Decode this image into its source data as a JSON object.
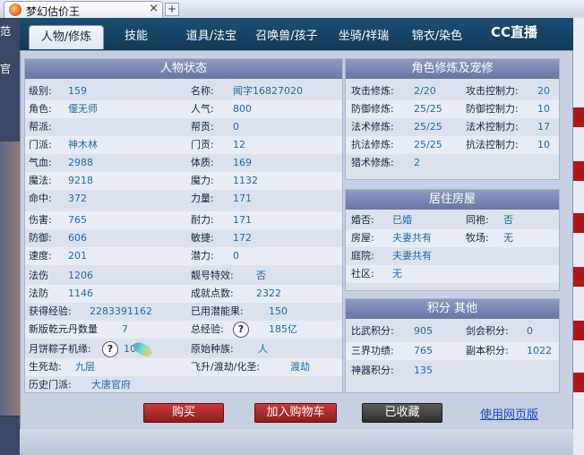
{
  "browser": {
    "tab_title": "梦幻估价王",
    "close": "×",
    "new_tab": "+",
    "left_text": "范",
    "left_text2": "官"
  },
  "tabs": [
    {
      "label": "人物/修炼",
      "active": true
    },
    {
      "label": "技能"
    },
    {
      "label": "道具/法宝"
    },
    {
      "label": "召唤兽/孩子"
    },
    {
      "label": "坐骑/祥瑞"
    },
    {
      "label": "锦衣/染色"
    }
  ],
  "logo": "CC直播",
  "status": {
    "title": "人物状态",
    "left": [
      {
        "label": "级别:",
        "value": "159"
      },
      {
        "label": "角色:",
        "value": "偃无师"
      },
      {
        "label": "帮派:",
        "value": ""
      },
      {
        "label": "门派:",
        "value": "神木林"
      },
      {
        "label": "气血:",
        "value": "2988"
      },
      {
        "label": "魔法:",
        "value": "9218"
      },
      {
        "label": "命中:",
        "value": "372"
      },
      {
        "label": "伤害:",
        "value": "765"
      },
      {
        "label": "防御:",
        "value": "606"
      },
      {
        "label": "速度:",
        "value": "201"
      },
      {
        "label": "法伤",
        "value": "1206"
      },
      {
        "label": "法防",
        "value": "1146"
      }
    ],
    "right": [
      {
        "label": "名称:",
        "value": "闻字16827020"
      },
      {
        "label": "人气:",
        "value": "800"
      },
      {
        "label": "帮贡:",
        "value": "0"
      },
      {
        "label": "门贡:",
        "value": "12"
      },
      {
        "label": "体质:",
        "value": "169"
      },
      {
        "label": "魔力:",
        "value": "1132"
      },
      {
        "label": "力量:",
        "value": "171"
      },
      {
        "label": "耐力:",
        "value": "171"
      },
      {
        "label": "敏捷:",
        "value": "172"
      },
      {
        "label": "潜力:",
        "value": "0"
      },
      {
        "label": "靓号特效:",
        "value": "否"
      },
      {
        "label": "成就点数:",
        "value": "2322"
      }
    ],
    "exp_label": "获得经验:",
    "exp_value": "2283391162",
    "potential_label": "已用潜能果:",
    "potential_value": "150",
    "qiankun_label": "新版乾元丹数量",
    "qiankun_value": "7",
    "total_exp_label": "总经验:",
    "total_exp_value": "185亿",
    "zongzi_label": "月饼粽子机缘:",
    "zongzi_value": "10",
    "race_label": "原始种族:",
    "race_value": "人",
    "shengsi_label": "生死劫:",
    "shengsi_value": "九层",
    "feisheng_label": "飞升/渡劫/化圣:",
    "feisheng_value": "渡劫",
    "history_label": "历史门派:",
    "history_value": "大唐官府",
    "question": "?"
  },
  "cultivation": {
    "title": "角色修炼及宠修",
    "rows": [
      {
        "label": "攻击修炼:",
        "value": "2/20",
        "label2": "攻击控制力:",
        "value2": "20"
      },
      {
        "label": "防御修炼:",
        "value": "25/25",
        "label2": "防御控制力:",
        "value2": "10"
      },
      {
        "label": "法术修炼:",
        "value": "25/25",
        "label2": "法术控制力:",
        "value2": "17"
      },
      {
        "label": "抗法修炼:",
        "value": "25/25",
        "label2": "抗法控制力:",
        "value2": "10"
      },
      {
        "label": "猎术修炼:",
        "value": "2",
        "label2": "",
        "value2": ""
      }
    ]
  },
  "housing": {
    "title": "居住房屋",
    "rows": [
      {
        "label": "婚否:",
        "value": "已婚",
        "label2": "同袍:",
        "value2": "否"
      },
      {
        "label": "房屋:",
        "value": "夫妻共有",
        "label2": "牧场:",
        "value2": "无"
      },
      {
        "label": "庭院:",
        "value": "夫妻共有",
        "label2": "",
        "value2": ""
      },
      {
        "label": "社区:",
        "value": "无",
        "label2": "",
        "value2": ""
      }
    ]
  },
  "points": {
    "title": "积分 其他",
    "rows": [
      {
        "label": "比武积分:",
        "value": "905",
        "label2": "剑会积分:",
        "value2": "0"
      },
      {
        "label": "三界功绩:",
        "value": "765",
        "label2": "副本积分:",
        "value2": "1022"
      },
      {
        "label": "神器积分:",
        "value": "135",
        "label2": "",
        "value2": ""
      }
    ]
  },
  "actions": {
    "buy": "购买",
    "add_cart": "加入购物车",
    "favorited": "已收藏",
    "web_version": "使用网页版"
  }
}
